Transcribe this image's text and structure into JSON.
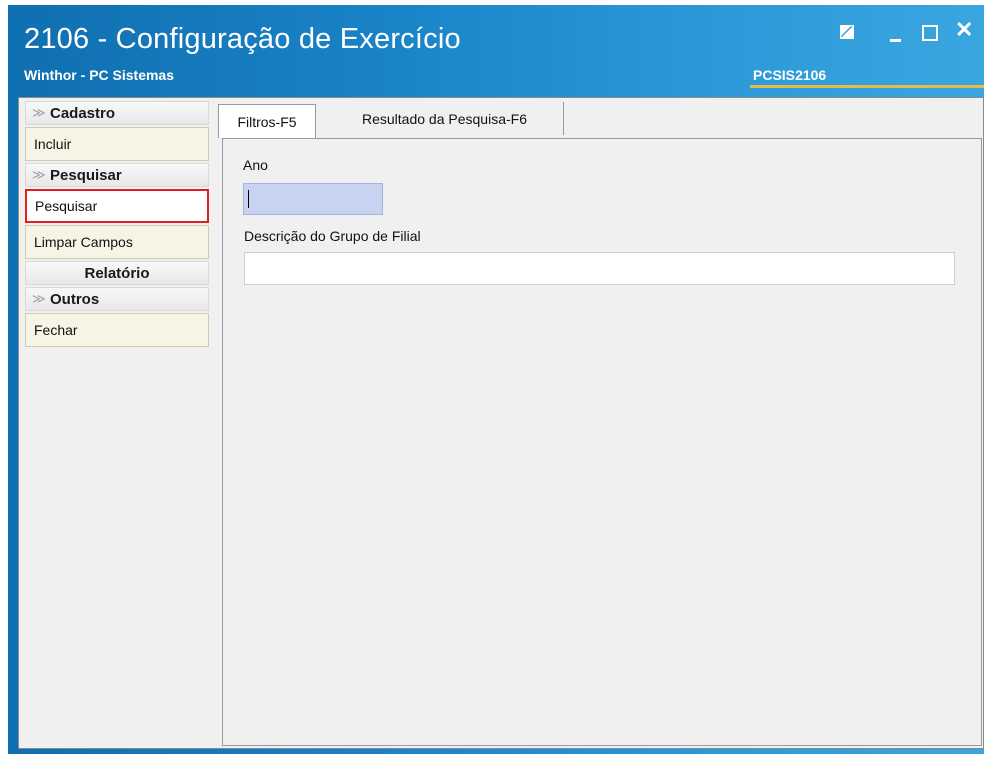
{
  "window": {
    "title": "2106 - Configuração de Exercício",
    "subtitle": "Winthor - PC Sistemas",
    "program_code": "PCSIS2106",
    "controls": [
      "restore-icon",
      "minimize-icon",
      "maximize-icon",
      "close-icon"
    ],
    "close_glyph": "✕"
  },
  "sidebar": {
    "sections": {
      "cadastro": "Cadastro",
      "pesquisar": "Pesquisar",
      "relatorio": "Relatório",
      "outros": "Outros"
    },
    "buttons": {
      "incluir": "Incluir",
      "pesquisar": "Pesquisar",
      "limpar_campos": "Limpar Campos",
      "fechar": "Fechar"
    },
    "chevron_glyph": "≫"
  },
  "tabs": [
    {
      "label": "Filtros-F5",
      "active": true
    },
    {
      "label": "Resultado da Pesquisa-F6",
      "active": false
    }
  ],
  "filters": {
    "ano_label": "Ano",
    "ano_value": "",
    "descricao_label": "Descrição do Grupo de Filial",
    "descricao_value": ""
  },
  "colors": {
    "titlebar_start": "#0f6fb0",
    "titlebar_end": "#3aa6e0",
    "highlight_border": "#e02020",
    "accent_line": "#e8b84a",
    "focused_input": "#c7d3f0"
  }
}
